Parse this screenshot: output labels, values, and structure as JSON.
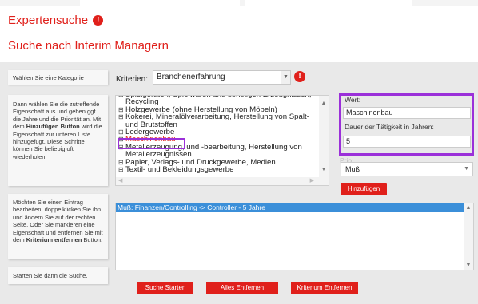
{
  "header": {
    "title": "Expertensuche",
    "subtitle": "Suche nach Interim Managern"
  },
  "steps": [
    {
      "text": "Wählen Sie eine Kategorie"
    },
    {
      "part1": "Dann wählen Sie die zutreffende Eigenschaft aus und geben ggf. die Jahre und die Priorität an. Mit dem ",
      "bold": "Hinzufügen Button",
      "part2": " wird die Eigenschaft zur unteren Liste hinzugefügt. Diese Schritte können Sie beliebig oft wiederholen."
    },
    {
      "part1": "Möchten Sie einen Eintrag bearbeiten, doppelklicken Sie ihn und ändern Sie auf der rechten Seite. Oder Sie markieren eine Eigenschaft und entfernen Sie mit dem ",
      "bold": "Kriterium entfernen",
      "part2": " Button."
    },
    {
      "text": "Starten Sie dann die Suche."
    }
  ],
  "kriterien": {
    "label": "Kriterien:",
    "selected": "Branchenerfahrung"
  },
  "tree_items": [
    "Spielgeräten, Spielwaren und sonstigen Erzeugnissen, Recycling",
    "Holzgewerbe (ohne Herstellung von Möbeln)",
    "Kokerei, Mineralölverarbeitung, Herstellung von Spalt- und Brutstoffen",
    "Ledergewerbe",
    "Maschinenbau",
    "Metallerzeugung, und -bearbeitung, Herstellung von Metallerzeugnissen",
    "Papier, Verlags- und Druckgewerbe, Medien",
    "Textil- und Bekleidungsgewerbe"
  ],
  "form": {
    "wert_label": "Wert:",
    "wert_value": "Maschinenbau",
    "dauer_label": "Dauer der Tätigkeit in Jahren:",
    "dauer_value": "5",
    "prio_label": "Prio:",
    "prio_value": "Muß",
    "add_button": "Hinzufügen"
  },
  "results": [
    "Muß: Finanzen/Controlling -> Controller - 5 Jahre"
  ],
  "buttons": {
    "start": "Suche Starten",
    "remove_all": "Alles Entfernen",
    "remove_criterion": "Kriterium Entfernen"
  },
  "colors": {
    "accent": "#e0201b",
    "highlight": "#9b30d9",
    "selection": "#3b8fd9"
  }
}
